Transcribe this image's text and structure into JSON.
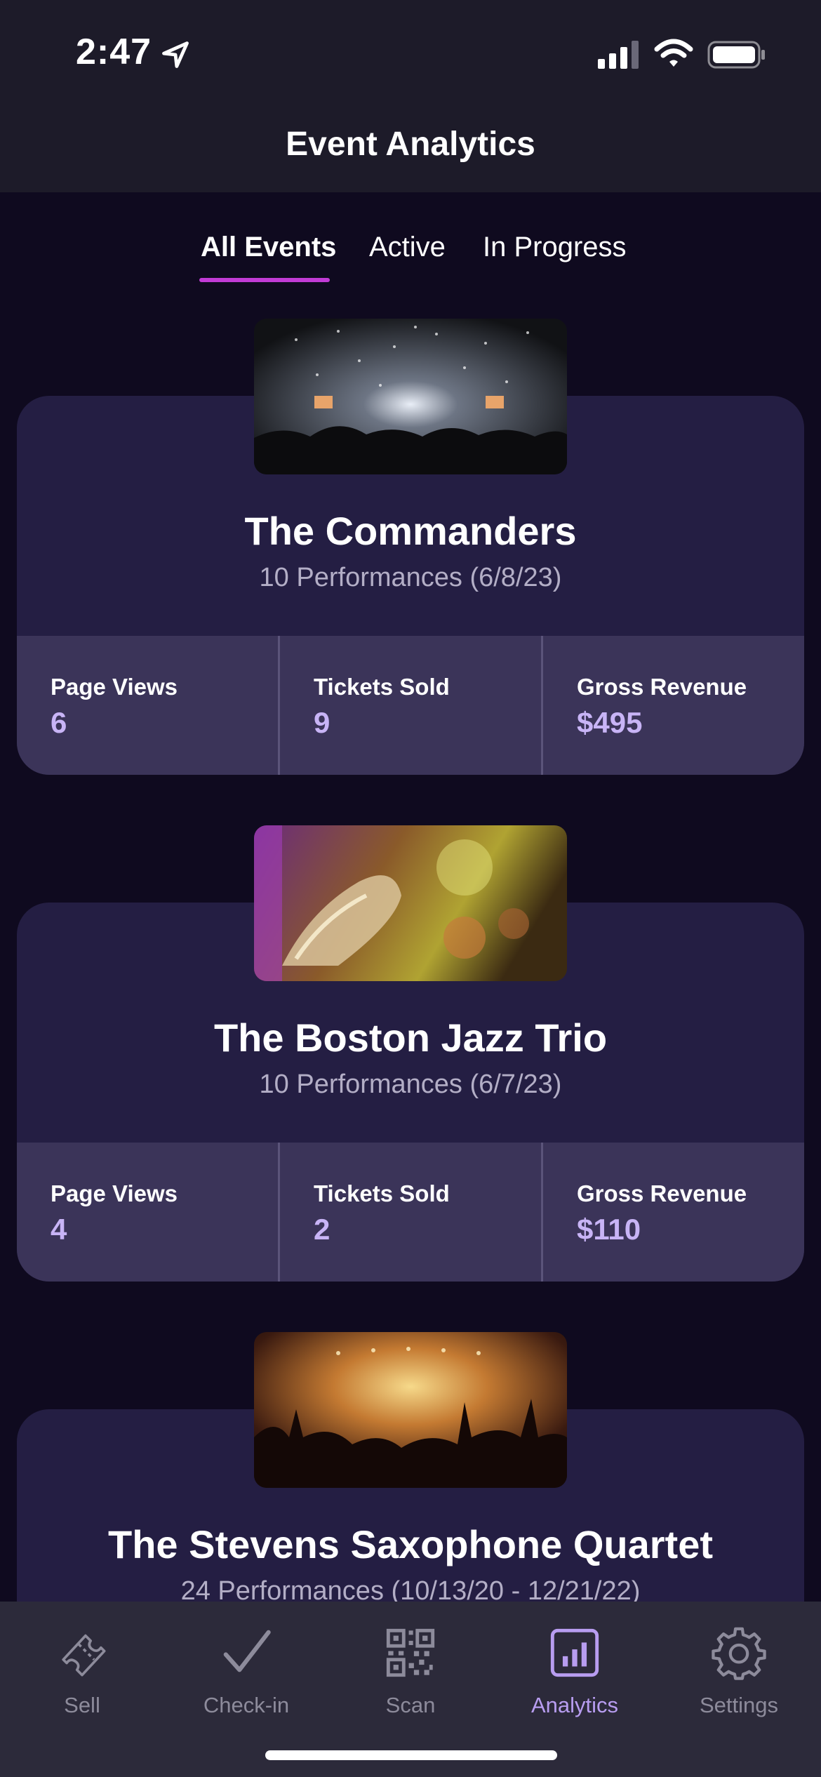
{
  "status_bar": {
    "time": "2:47"
  },
  "header": {
    "title": "Event Analytics"
  },
  "filter_tabs": [
    {
      "label": "All Events",
      "active": true
    },
    {
      "label": "Active",
      "active": false
    },
    {
      "label": "In Progress",
      "active": false
    }
  ],
  "events": [
    {
      "title": "The Commanders",
      "subtitle": "10 Performances (6/8/23)",
      "stats": [
        {
          "label": "Page Views",
          "value": "6"
        },
        {
          "label": "Tickets Sold",
          "value": "9"
        },
        {
          "label": "Gross Revenue",
          "value": "$495"
        }
      ]
    },
    {
      "title": "The Boston Jazz Trio",
      "subtitle": "10 Performances (6/7/23)",
      "stats": [
        {
          "label": "Page Views",
          "value": "4"
        },
        {
          "label": "Tickets Sold",
          "value": "2"
        },
        {
          "label": "Gross Revenue",
          "value": "$110"
        }
      ]
    },
    {
      "title": "The Stevens Saxophone Quartet",
      "subtitle": "24 Performances (10/13/20 - 12/21/22)",
      "stats": []
    }
  ],
  "tab_bar": [
    {
      "label": "Sell",
      "icon": "ticket-icon",
      "selected": false
    },
    {
      "label": "Check-in",
      "icon": "checkmark-icon",
      "selected": false
    },
    {
      "label": "Scan",
      "icon": "qr-code-icon",
      "selected": false
    },
    {
      "label": "Analytics",
      "icon": "analytics-icon",
      "selected": true
    },
    {
      "label": "Settings",
      "icon": "gear-icon",
      "selected": false
    }
  ],
  "colors": {
    "background": "#0f0a1f",
    "card": "#241e43",
    "stats_panel": "#3b3459",
    "accent": "#c23bd6",
    "stat_value": "#c8b4f6",
    "tab_selected": "#b89df0",
    "tab_unselected": "#8d8b9b"
  }
}
